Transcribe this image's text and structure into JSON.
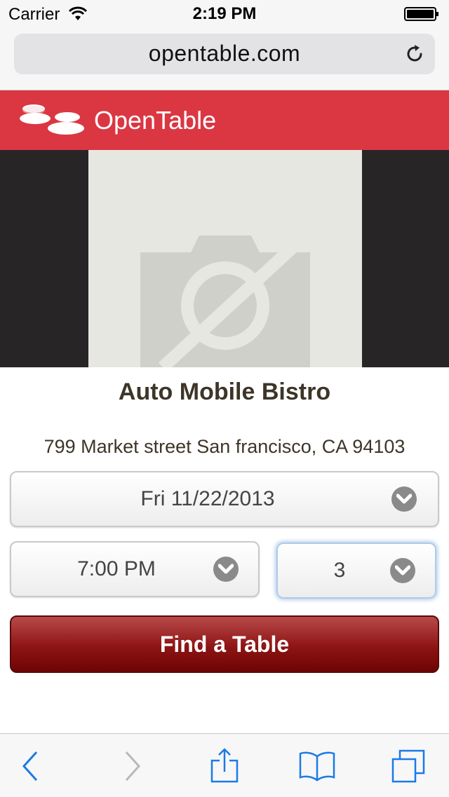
{
  "status_bar": {
    "carrier": "Carrier",
    "time": "2:19 PM"
  },
  "browser": {
    "url": "opentable.com"
  },
  "header": {
    "brand": "OpenTable",
    "brand_color": "#da3743"
  },
  "restaurant": {
    "name": "Auto Mobile Bistro",
    "address": "799 Market street San francisco, CA 94103"
  },
  "reservation": {
    "date": "Fri 11/22/2013",
    "time": "7:00 PM",
    "party_size": "3",
    "find_button_label": "Find a Table"
  },
  "colors": {
    "button": "#8e1414",
    "toolbar_icon": "#1a7ae6"
  }
}
